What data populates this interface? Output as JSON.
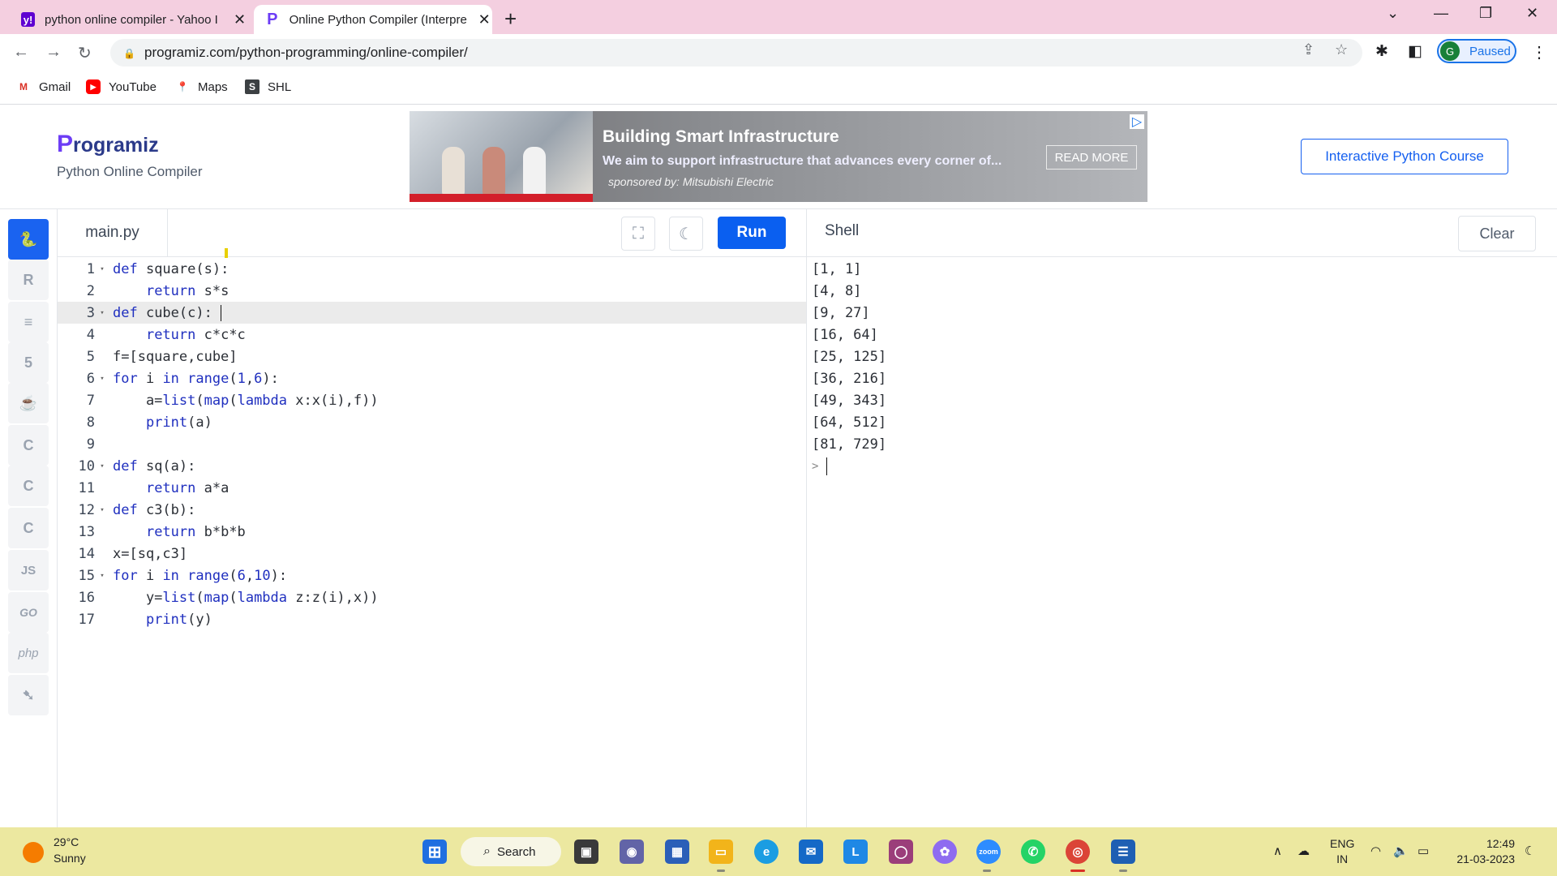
{
  "browser": {
    "tabs": [
      {
        "title": "python online compiler - Yahoo I",
        "favicon": "yahoo-icon"
      },
      {
        "title": "Online Python Compiler (Interpre",
        "favicon": "programiz-icon",
        "active": true
      }
    ],
    "url": "programiz.com/python-programming/online-compiler/",
    "profile_initial": "G",
    "profile_status": "Paused",
    "bookmarks": [
      {
        "label": "Gmail",
        "icon": "gmail-icon"
      },
      {
        "label": "YouTube",
        "icon": "youtube-icon"
      },
      {
        "label": "Maps",
        "icon": "maps-icon"
      },
      {
        "label": "SHL",
        "icon": "shl-icon"
      }
    ]
  },
  "site": {
    "logo_first": "P",
    "logo_rest": "rogramiz",
    "subtitle": "Python Online Compiler",
    "course_button": "Interactive Python Course",
    "ad": {
      "title": "Building Smart Infrastructure",
      "text": "We aim to support infrastructure that advances every corner of...",
      "sponsor": "sponsored by: Mitsubishi Electric",
      "button": "READ MORE"
    }
  },
  "sidebar": {
    "languages": [
      {
        "name": "python-icon",
        "glyph": "🐍",
        "active": true
      },
      {
        "name": "r-icon",
        "glyph": "R"
      },
      {
        "name": "sql-icon",
        "glyph": "≡"
      },
      {
        "name": "html-icon",
        "glyph": "5"
      },
      {
        "name": "java-icon",
        "glyph": "☕"
      },
      {
        "name": "c-icon",
        "glyph": "C"
      },
      {
        "name": "cpp-icon",
        "glyph": "C"
      },
      {
        "name": "csharp-icon",
        "glyph": "C"
      },
      {
        "name": "js-icon",
        "glyph": "JS"
      },
      {
        "name": "go-icon",
        "glyph": "GO"
      },
      {
        "name": "php-icon",
        "glyph": "php"
      },
      {
        "name": "swift-icon",
        "glyph": "➷"
      }
    ]
  },
  "editor": {
    "filename": "main.py",
    "run_label": "Run",
    "lines": [
      {
        "n": "1",
        "fold": true,
        "code": "def square(s):"
      },
      {
        "n": "2",
        "fold": false,
        "code": "    return s*s"
      },
      {
        "n": "3",
        "fold": true,
        "code": "def cube(c):",
        "highlight": true
      },
      {
        "n": "4",
        "fold": false,
        "code": "    return c*c*c"
      },
      {
        "n": "5",
        "fold": false,
        "code": "f=[square,cube]"
      },
      {
        "n": "6",
        "fold": true,
        "code": "for i in range(1,6):"
      },
      {
        "n": "7",
        "fold": false,
        "code": "    a=list(map(lambda x:x(i),f))"
      },
      {
        "n": "8",
        "fold": false,
        "code": "    print(a)"
      },
      {
        "n": "9",
        "fold": false,
        "code": ""
      },
      {
        "n": "10",
        "fold": true,
        "code": "def sq(a):"
      },
      {
        "n": "11",
        "fold": false,
        "code": "    return a*a"
      },
      {
        "n": "12",
        "fold": true,
        "code": "def c3(b):"
      },
      {
        "n": "13",
        "fold": false,
        "code": "    return b*b*b"
      },
      {
        "n": "14",
        "fold": false,
        "code": "x=[sq,c3]"
      },
      {
        "n": "15",
        "fold": true,
        "code": "for i in range(6,10):"
      },
      {
        "n": "16",
        "fold": false,
        "code": "    y=list(map(lambda z:z(i),x))"
      },
      {
        "n": "17",
        "fold": false,
        "code": "    print(y)"
      }
    ]
  },
  "shell": {
    "title": "Shell",
    "clear_label": "Clear",
    "output": [
      "[1, 1]",
      "[4, 8]",
      "[9, 27]",
      "[16, 64]",
      "[25, 125]",
      "[36, 216]",
      "[49, 343]",
      "[64, 512]",
      "[81, 729]"
    ],
    "prompt": ">"
  },
  "taskbar": {
    "temperature": "29°C",
    "condition": "Sunny",
    "search_label": "Search",
    "language": "ENG",
    "region": "IN",
    "time": "12:49",
    "date": "21-03-2023"
  }
}
